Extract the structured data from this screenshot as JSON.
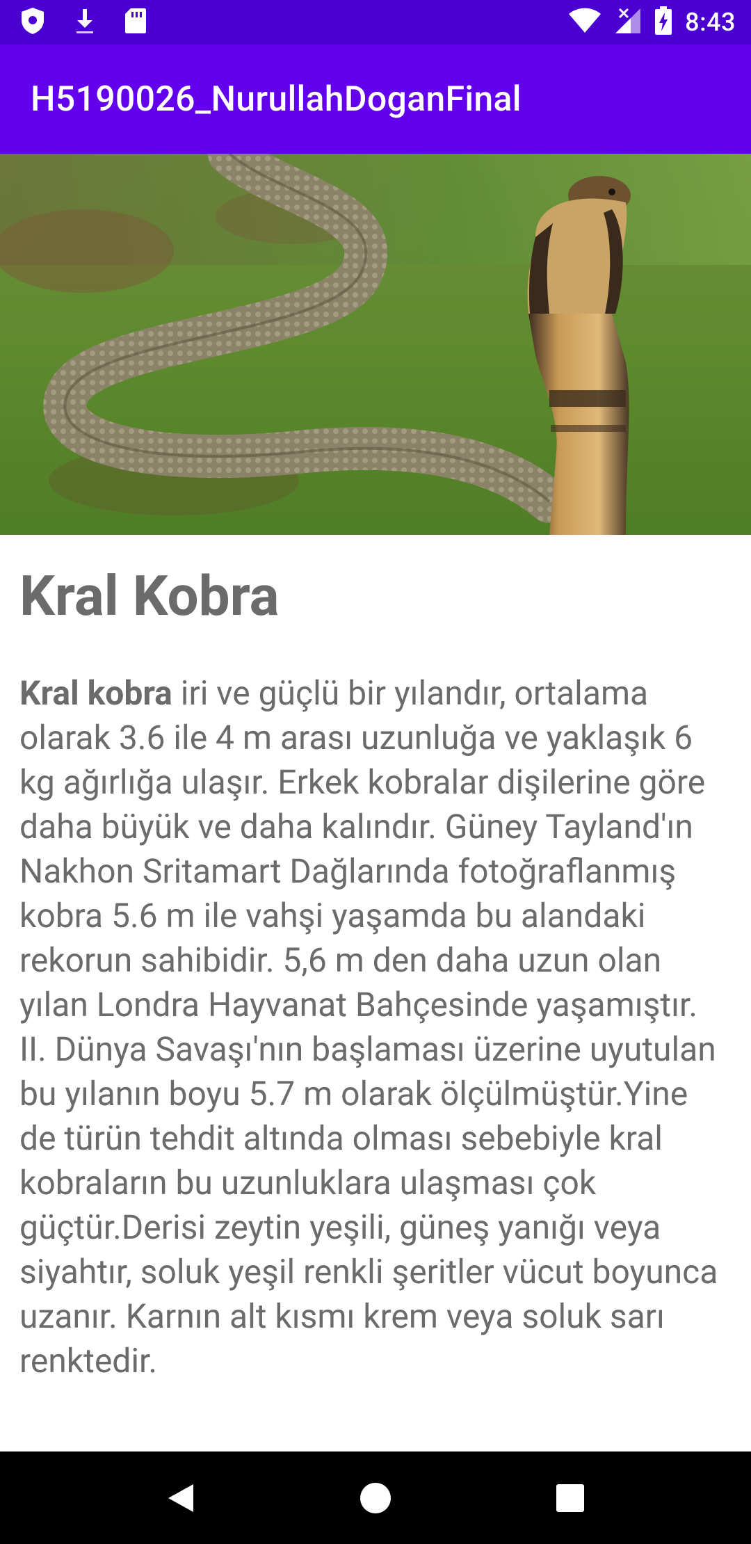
{
  "status_bar": {
    "time": "8:43",
    "icons": [
      "shield-icon",
      "download-icon",
      "sd-card-icon",
      "wifi-icon",
      "signal-icon",
      "battery-charging-icon"
    ],
    "background": "#4a00d1"
  },
  "app_bar": {
    "title": "H5190026_NurullahDoganFinal",
    "background": "#6200ee"
  },
  "hero_image": {
    "subject": "king cobra on grass",
    "icon": "cobra-photo"
  },
  "article": {
    "title": "Kral Kobra",
    "lead_bold": "Kral kobra",
    "body": " iri ve güçlü bir yılandır, ortalama olarak 3.6 ile 4 m arası uzunluğa ve yaklaşık 6 kg ağırlığa ulaşır. Erkek kobralar dişilerine göre daha büyük ve daha kalındır. Güney Tayland'ın Nakhon Sritamart Dağlarında fotoğraflanmış kobra 5.6 m ile vahşi yaşamda bu alandaki rekorun sahibidir. 5,6 m den daha uzun olan yılan Londra Hayvanat Bahçesinde yaşamıştır. II. Dünya Savaşı'nın başlaması üzerine uyutulan bu yılanın boyu 5.7 m olarak ölçülmüştür.Yine de türün tehdit altında olması sebebiyle kral kobraların bu uzunluklara ulaşması çok güçtür.Derisi zeytin yeşili, güneş yanığı veya siyahtır, soluk yeşil renkli şeritler vücut boyunca uzanır. Karnın alt kısmı krem veya soluk sarı renktedir."
  },
  "nav_bar": {
    "buttons": [
      "back-icon",
      "home-icon",
      "recents-icon"
    ]
  }
}
